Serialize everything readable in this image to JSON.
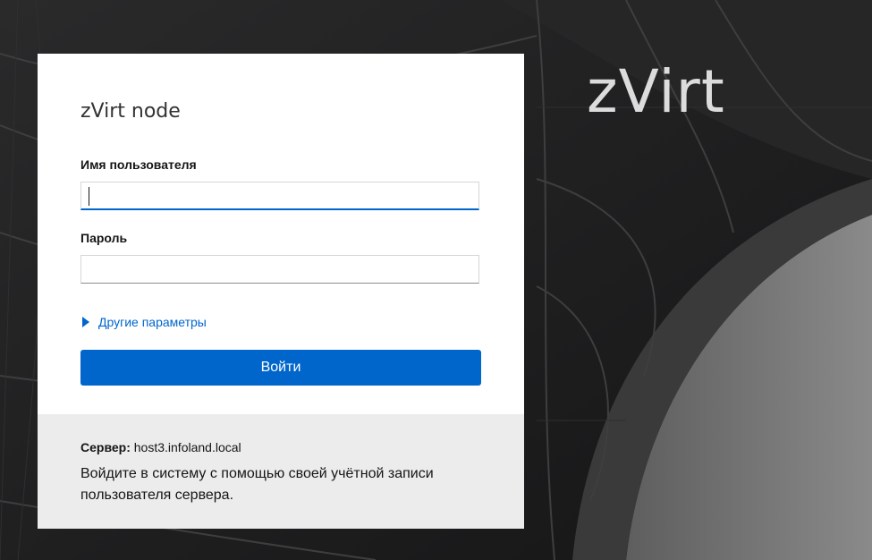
{
  "brand": {
    "logo_text": "zVirt"
  },
  "login": {
    "title": "zVirt node",
    "username": {
      "label": "Имя пользователя",
      "value": "",
      "placeholder": ""
    },
    "password": {
      "label": "Пароль",
      "value": "",
      "placeholder": ""
    },
    "more_options": "Другие параметры",
    "submit_label": "Войти"
  },
  "footer": {
    "server_label": "Сервер:",
    "server_value": "host3.infoland.local",
    "info_text": "Войдите в систему с помощью своей учётной записи пользователя сервера."
  },
  "colors": {
    "accent": "#0066cc",
    "background": "#1d1d1e",
    "footer": "#ececec"
  },
  "icons": {
    "more_options": "caret-right-icon"
  }
}
